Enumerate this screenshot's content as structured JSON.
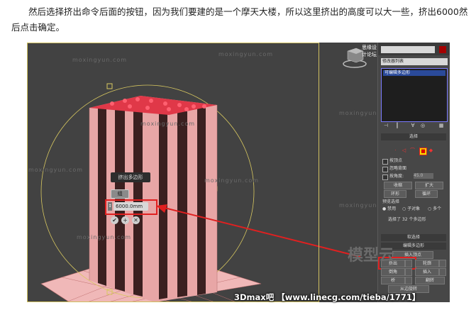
{
  "article": {
    "paragraph": "然后选择挤出命令后面的按钮，因为我们要建的是一个摩天大楼，所以这里挤出的高度可以大一些，挤出6000然后点击确定。"
  },
  "viewport": {
    "watermark": "moxingyun.com",
    "caddy": {
      "title": "挤出多边形",
      "mode": "组",
      "value": "6000.0mm"
    }
  },
  "command_panel": {
    "top_watermark": "思缘设计论坛",
    "modifier_list": "修改器列表",
    "stack_item": "可编辑多边形",
    "selection_title": "选择",
    "selection_options": {
      "by_vertex": "按顶点",
      "ignore_backfacing": "忽略背面",
      "by_angle": "按角度:",
      "angle_value": "45.0"
    },
    "buttons": {
      "shrink": "收缩",
      "grow": "扩大",
      "ring": "环形",
      "loop": "循环"
    },
    "preview_selection": {
      "title": "预览选择",
      "disabled": "禁用",
      "subobject": "子对象",
      "multi": "多个"
    },
    "status": "选择了 32 个多边形",
    "soft_selection": "软选择",
    "edit_polygons": "编辑多边形",
    "edit_buttons": {
      "insert_vertex": "插入顶点",
      "extrude": "挤出",
      "outline": "轮廓",
      "bevel": "倒角",
      "inset": "插入",
      "bridge": "桥",
      "flip": "翻转",
      "hinge": "从边旋转"
    },
    "big_watermark": "模型云"
  },
  "footer": "3Dmax吧 【www.linecg.com/tieba/1771】",
  "colors": {
    "accent_red": "#e02020",
    "building_pink": "#e8a6a6",
    "grid_pink": "#f0b8b8",
    "gizmo_yellow": "#d8c860"
  }
}
